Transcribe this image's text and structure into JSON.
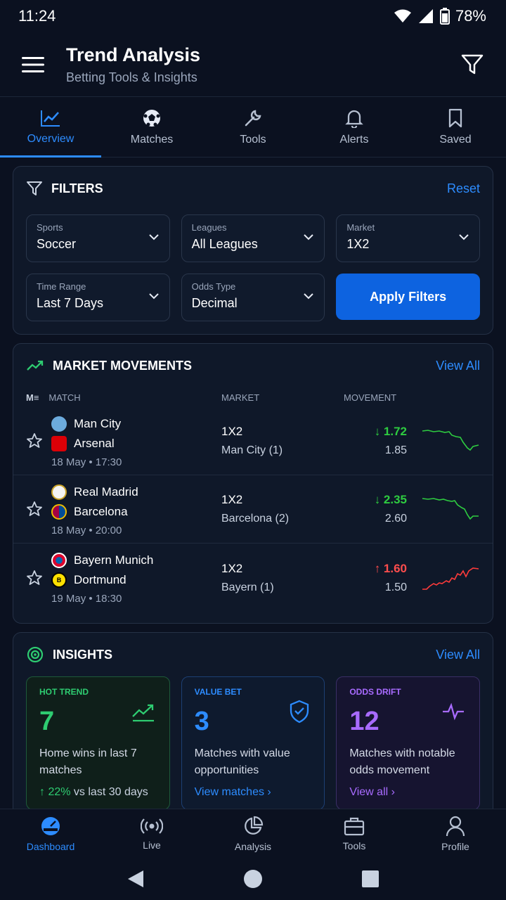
{
  "status": {
    "time": "11:24",
    "battery": "78%"
  },
  "header": {
    "title": "Trend Analysis",
    "subtitle": "Betting Tools & Insights"
  },
  "tabs": [
    {
      "label": "Overview",
      "icon": "trend-line-icon"
    },
    {
      "label": "Matches",
      "icon": "soccer-ball-icon"
    },
    {
      "label": "Tools",
      "icon": "wrench-icon"
    },
    {
      "label": "Alerts",
      "icon": "bell-icon"
    },
    {
      "label": "Saved",
      "icon": "bookmark-icon"
    }
  ],
  "filters": {
    "title": "FILTERS",
    "reset": "Reset",
    "sports": {
      "label": "Sports",
      "value": "Soccer"
    },
    "leagues": {
      "label": "Leagues",
      "value": "All Leagues"
    },
    "market": {
      "label": "Market",
      "value": "1X2"
    },
    "time_range": {
      "label": "Time Range",
      "value": "Last 7 Days"
    },
    "odds_type": {
      "label": "Odds Type",
      "value": "Decimal"
    },
    "apply": "Apply Filters"
  },
  "market_movements": {
    "title": "MARKET MOVEMENTS",
    "view_all": "View All",
    "columns": {
      "match": "MATCH",
      "market": "MARKET",
      "movement": "MOVEMENT"
    },
    "rows": [
      {
        "home": "Man City",
        "away": "Arsenal",
        "kickoff": "18 May • 17:30",
        "market": "1X2",
        "selection": "Man City (1)",
        "current": "↓ 1.72",
        "previous": "1.85",
        "direction": "down"
      },
      {
        "home": "Real Madrid",
        "away": "Barcelona",
        "kickoff": "18 May • 20:00",
        "market": "1X2",
        "selection": "Barcelona (2)",
        "current": "↓ 2.35",
        "previous": "2.60",
        "direction": "down"
      },
      {
        "home": "Bayern Munich",
        "away": "Dortmund",
        "kickoff": "19 May • 18:30",
        "market": "1X2",
        "selection": "Bayern (1)",
        "current": "↑ 1.60",
        "previous": "1.50",
        "direction": "up"
      }
    ]
  },
  "insights": {
    "title": "INSIGHTS",
    "view_all": "View All",
    "cards": [
      {
        "tag": "HOT TREND",
        "value": "7",
        "desc": "Home wins in last 7 matches",
        "foot_prefix": "↑ 22%",
        "foot": " vs last 30 days"
      },
      {
        "tag": "VALUE BET",
        "value": "3",
        "desc": "Matches with value opportunities",
        "foot": "View matches  ›"
      },
      {
        "tag": "ODDS DRIFT",
        "value": "12",
        "desc": "Matches with notable odds movement",
        "foot": "View all  ›"
      }
    ]
  },
  "bottom_nav": [
    {
      "label": "Dashboard"
    },
    {
      "label": "Live"
    },
    {
      "label": "Analysis"
    },
    {
      "label": "Tools"
    },
    {
      "label": "Profile"
    }
  ],
  "colors": {
    "accent": "#2d8cff",
    "up": "#ff4d4d",
    "down": "#2ecc40",
    "trend": "#2ecc71",
    "value": "#2d8cff",
    "drift": "#a86bff"
  }
}
